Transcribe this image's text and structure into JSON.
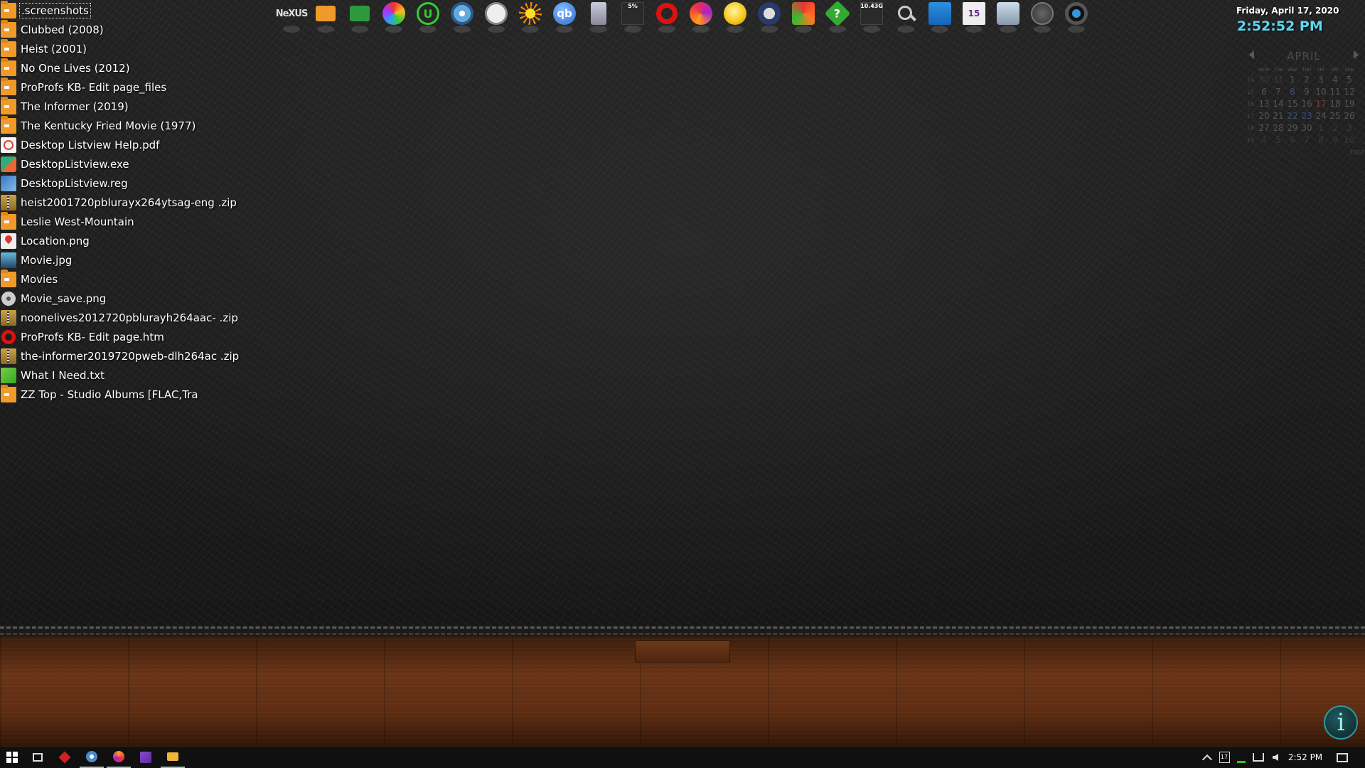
{
  "desktop": {
    "items": [
      {
        "label": ".screenshots",
        "icon": "folder-icon",
        "selected": true
      },
      {
        "label": "Clubbed (2008)",
        "icon": "folder-icon"
      },
      {
        "label": "Heist (2001)",
        "icon": "folder-icon"
      },
      {
        "label": "No One Lives (2012)",
        "icon": "folder-icon"
      },
      {
        "label": "ProProfs KB- Edit page_files",
        "icon": "folder-icon"
      },
      {
        "label": "The Informer (2019)",
        "icon": "folder-icon"
      },
      {
        "label": "The Kentucky Fried Movie (1977)",
        "icon": "folder-icon"
      },
      {
        "label": "Desktop Listview Help.pdf",
        "icon": "pdf-icon"
      },
      {
        "label": "DesktopListview.exe",
        "icon": "exe-icon"
      },
      {
        "label": "DesktopListview.reg",
        "icon": "registry-icon"
      },
      {
        "label": "heist2001720pblurayx264ytsag-eng .zip",
        "icon": "zip-icon"
      },
      {
        "label": "Leslie West-Mountain",
        "icon": "folder-icon"
      },
      {
        "label": "Location.png",
        "icon": "location-pin-icon"
      },
      {
        "label": "Movie.jpg",
        "icon": "image-icon"
      },
      {
        "label": "Movies",
        "icon": "folder-icon"
      },
      {
        "label": "Movie_save.png",
        "icon": "film-reel-icon"
      },
      {
        "label": "noonelives2012720pblurayh264aac- .zip",
        "icon": "zip-icon"
      },
      {
        "label": "ProProfs KB- Edit page.htm",
        "icon": "opera-icon"
      },
      {
        "label": "the-informer2019720pweb-dlh264ac .zip",
        "icon": "zip-icon"
      },
      {
        "label": "What I Need.txt",
        "icon": "text-file-icon"
      },
      {
        "label": "ZZ Top - Studio Albums [FLAC,Tra",
        "icon": "folder-icon"
      }
    ]
  },
  "dock": {
    "items": [
      {
        "name": "nexus-logo-icon",
        "glyph": "NeXUS"
      },
      {
        "name": "folder-icon",
        "glyph": ""
      },
      {
        "name": "green-folder-icon",
        "glyph": ""
      },
      {
        "name": "color-petals-icon",
        "glyph": ""
      },
      {
        "name": "u-letter-icon",
        "glyph": "U"
      },
      {
        "name": "disk-utility-icon",
        "glyph": ""
      },
      {
        "name": "clock-icon",
        "glyph": ""
      },
      {
        "name": "sun-eye-icon",
        "glyph": ""
      },
      {
        "name": "qbittorrent-icon",
        "glyph": "qb"
      },
      {
        "name": "recycle-bin-icon",
        "glyph": ""
      },
      {
        "name": "cpu-meter-icon",
        "glyph": "5%"
      },
      {
        "name": "opera-icon",
        "glyph": ""
      },
      {
        "name": "firefox-icon",
        "glyph": ""
      },
      {
        "name": "weather-bulb-icon",
        "glyph": ""
      },
      {
        "name": "lock-icon",
        "glyph": ""
      },
      {
        "name": "refresh-arrows-icon",
        "glyph": ""
      },
      {
        "name": "help-diamond-icon",
        "glyph": "?"
      },
      {
        "name": "disk-gauge-icon",
        "glyph": "10.43G"
      },
      {
        "name": "search-icon",
        "glyph": ""
      },
      {
        "name": "vscode-icon",
        "glyph": ""
      },
      {
        "name": "visual-studio-icon",
        "glyph": "15"
      },
      {
        "name": "network-icon",
        "glyph": ""
      },
      {
        "name": "power-icon",
        "glyph": ""
      },
      {
        "name": "camera-icon",
        "glyph": ""
      }
    ]
  },
  "clock": {
    "date": "Friday, April 17, 2020",
    "time": "2:52:52 PM"
  },
  "calendar": {
    "month": "APRIL",
    "year": "2020",
    "weekday_headers": [
      "MON",
      "TUE",
      "WED",
      "THU",
      "FRI",
      "SAT",
      "SUN"
    ],
    "weeks": [
      {
        "wk": "14",
        "days": [
          "30",
          "31",
          "1",
          "2",
          "3",
          "4",
          "5"
        ]
      },
      {
        "wk": "15",
        "days": [
          "6",
          "7",
          "8",
          "9",
          "10",
          "11",
          "12"
        ]
      },
      {
        "wk": "16",
        "days": [
          "13",
          "14",
          "15",
          "16",
          "17",
          "18",
          "19"
        ]
      },
      {
        "wk": "17",
        "days": [
          "20",
          "21",
          "22",
          "23",
          "24",
          "25",
          "26"
        ]
      },
      {
        "wk": "18",
        "days": [
          "27",
          "28",
          "29",
          "30",
          "1",
          "2",
          "3"
        ]
      },
      {
        "wk": "19",
        "days": [
          "4",
          "5",
          "6",
          "7",
          "8",
          "9",
          "10"
        ]
      }
    ],
    "today": "17"
  },
  "taskbar": {
    "items": [
      {
        "name": "start-button",
        "icon": "windows-logo-icon"
      },
      {
        "name": "task-view-button",
        "icon": "task-view-icon"
      },
      {
        "name": "taskbar-app-red",
        "icon": "red-diamond-icon"
      },
      {
        "name": "taskbar-app-disk",
        "icon": "disk-utility-icon",
        "active": true
      },
      {
        "name": "taskbar-app-firefox",
        "icon": "firefox-icon",
        "active": true
      },
      {
        "name": "taskbar-app-visual-studio",
        "icon": "visual-studio-icon"
      },
      {
        "name": "taskbar-app-file-explorer",
        "icon": "folder-icon",
        "active": true
      }
    ],
    "tray": {
      "calendar_day": "17",
      "time": "2:52 PM"
    }
  },
  "colors": {
    "clock_time": "#5cd8f4",
    "folder": "#f09a2a",
    "taskbar": "#101010"
  }
}
